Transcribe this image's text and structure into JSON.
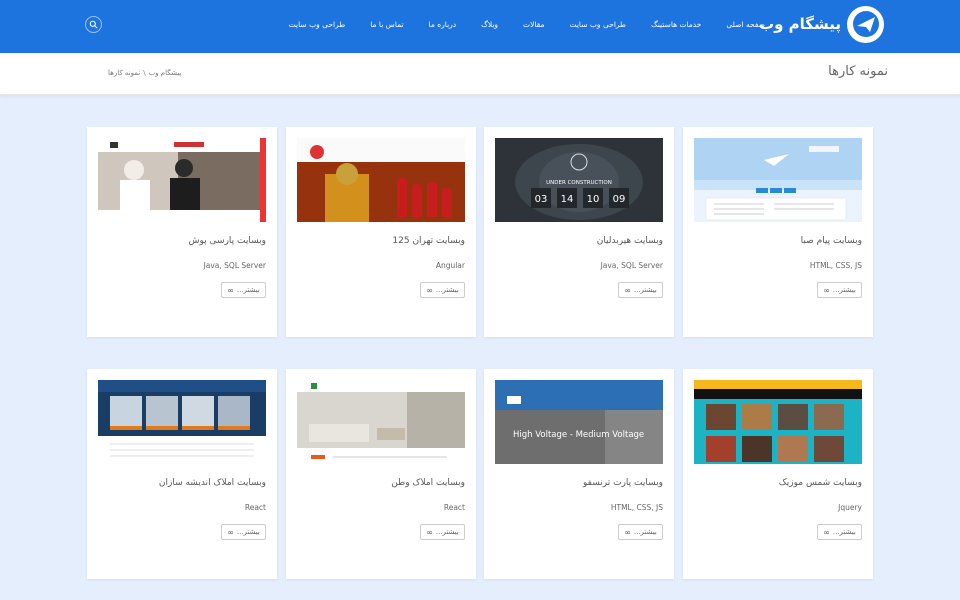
{
  "brand": {
    "name": "پیشگام وب"
  },
  "nav": {
    "items": [
      "صفحه اصلی",
      "خدمات هاستینگ",
      "طراحی وب سایت",
      "مقالات",
      "وبلاگ",
      "درباره ما",
      "تماس با ما",
      "طراحی وب سایت"
    ]
  },
  "header": {
    "title": "نمونه کارها",
    "breadcrumb": [
      "پیشگام وب",
      "\\",
      "نمونه کارها"
    ]
  },
  "cards": [
    {
      "title": "وبسایت پیام صبا",
      "tech": "HTML, CSS, JS",
      "more": "بیشتر..."
    },
    {
      "title": "وبسایت هیربدلیان",
      "tech": "Java, SQL Server",
      "more": "بیشتر..."
    },
    {
      "title": "وبسایت تهران 125",
      "tech": "Angular",
      "more": "بیشتر..."
    },
    {
      "title": "وبسایت پارسی پوش",
      "tech": "Java, SQL Server",
      "more": "بیشتر..."
    },
    {
      "title": "وبسایت شمس موزیک",
      "tech": "Jquery",
      "more": "بیشتر..."
    },
    {
      "title": "وبسایت پارت ترنسفو",
      "tech": "HTML, CSS, JS",
      "more": "بیشتر..."
    },
    {
      "title": "وبسایت املاک وطن",
      "tech": "React",
      "more": "بیشتر..."
    },
    {
      "title": "وبسایت املاک اندیشه سازان",
      "tech": "React",
      "more": "بیشتر..."
    }
  ],
  "thumbs": {
    "countdown": [
      "03",
      "14",
      "10",
      "09"
    ],
    "under_construction": "UNDER CONSTRUCTION",
    "voltage": "High Voltage - Medium Voltage"
  },
  "colors": {
    "accent": "#1d74df",
    "background": "#e4eefc"
  }
}
